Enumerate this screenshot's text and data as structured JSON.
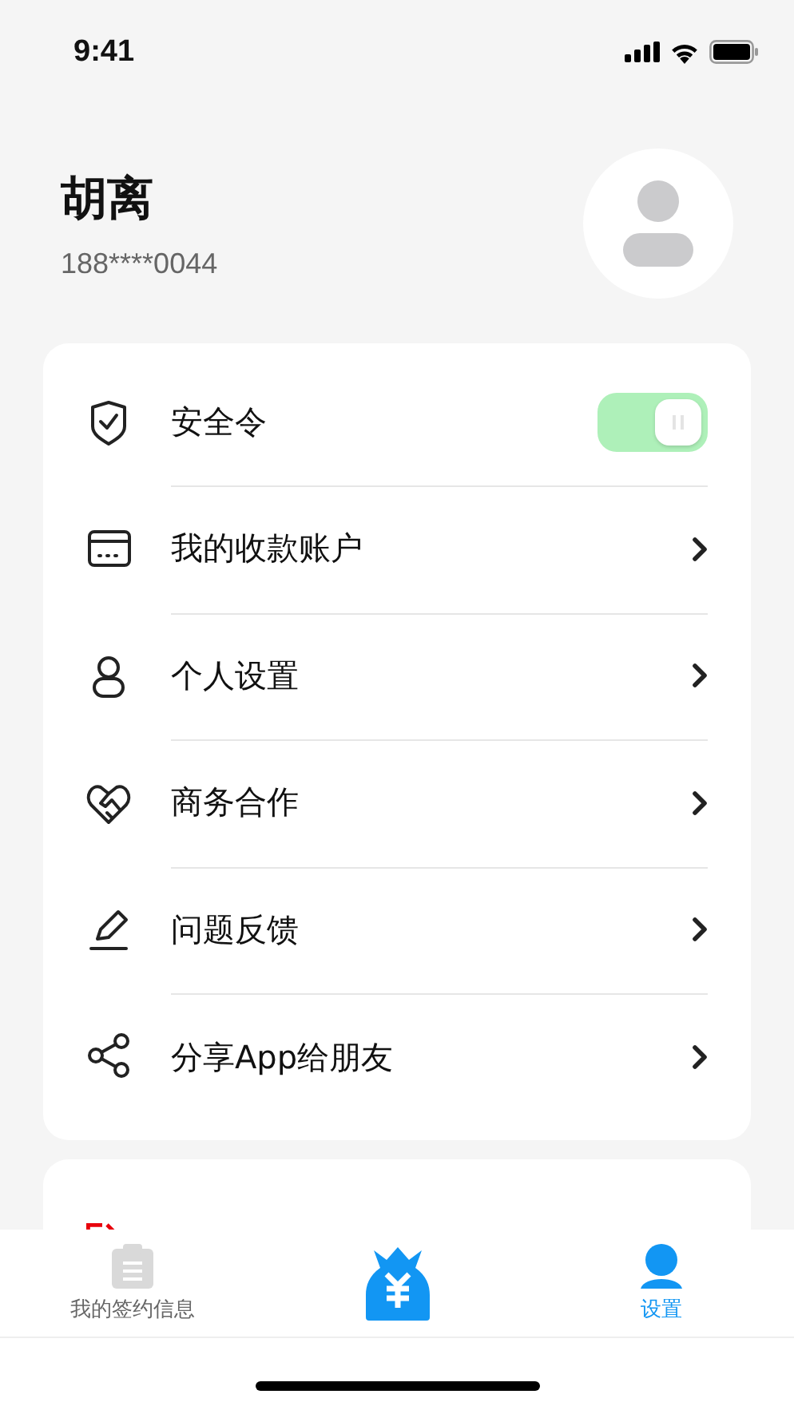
{
  "status_bar": {
    "time": "9:41"
  },
  "profile": {
    "name": "胡离",
    "phone": "188****0044"
  },
  "settings": [
    {
      "kind": "toggle",
      "label": "安全令",
      "on": true
    },
    {
      "kind": "link",
      "label": "我的收款账户"
    },
    {
      "kind": "link",
      "label": "个人设置"
    },
    {
      "kind": "link",
      "label": "商务合作"
    },
    {
      "kind": "link",
      "label": "问题反馈"
    },
    {
      "kind": "link",
      "label": "分享App给朋友"
    }
  ],
  "tab_bar": [
    {
      "kind": "labeled",
      "label": "我的签约信息",
      "selected": false
    },
    {
      "kind": "icon"
    },
    {
      "kind": "labeled",
      "label": "设置",
      "selected": true
    }
  ]
}
